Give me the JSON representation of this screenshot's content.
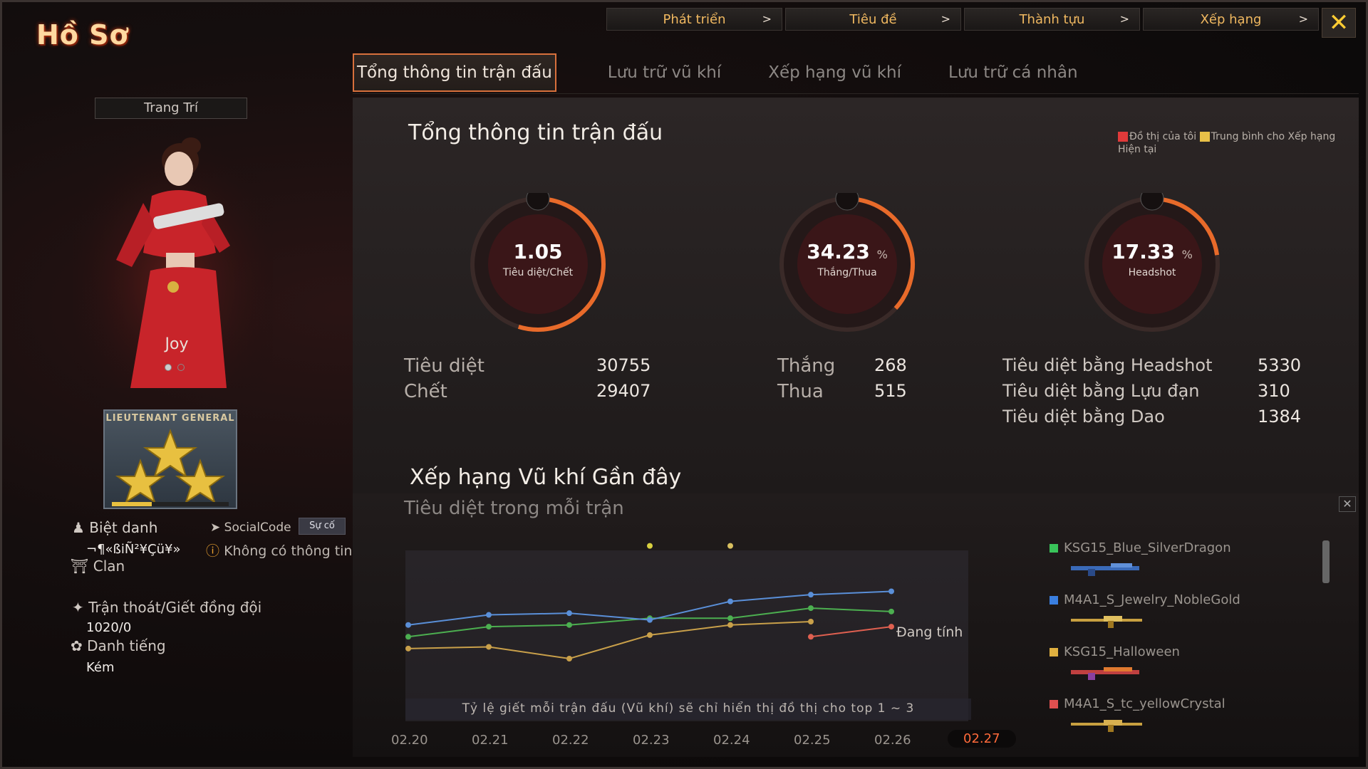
{
  "header": {
    "title": "Hồ Sơ"
  },
  "top_nav": [
    {
      "label": "Phát triển"
    },
    {
      "label": "Tiêu đề"
    },
    {
      "label": "Thành tựu"
    },
    {
      "label": "Xếp hạng"
    }
  ],
  "close_label": "✕",
  "tabs": [
    {
      "label": "Tổng thông tin trận đấu",
      "active": true
    },
    {
      "label": "Lưu trữ vũ khí"
    },
    {
      "label": "Xếp hạng vũ khí"
    },
    {
      "label": "Lưu trữ cá nhân"
    }
  ],
  "profile": {
    "decor_button": "Trang Trí",
    "character_name": "Joy",
    "rank_title": "LIEUTENANT GENERAL",
    "nickname_label": "Biệt danh",
    "nickname_value": "¬¶«ßiÑ²¥Çü¥»",
    "socialcode_label": "SocialCode",
    "socialcode_button": "Sự cố",
    "socialcode_value": "Không có thông tin",
    "clan_label": "Clan",
    "escape_label": "Trận thoát/Giết đồng đội",
    "escape_value": "1020/0",
    "reputation_label": "Danh tiếng",
    "reputation_value": "Kém"
  },
  "stats_panel": {
    "title": "Tổng thông tin trận đấu",
    "legend_mine": "Đồ thị của tôi",
    "legend_avg": "Trung bình cho Xếp hạng Hiện tại",
    "gauges": [
      {
        "value": "1.05",
        "unit": "",
        "label": "Tiêu diệt/Chết",
        "fill": 0.52
      },
      {
        "value": "34.23",
        "unit": "%",
        "label": "Thắng/Thua",
        "fill": 0.34
      },
      {
        "value": "17.33",
        "unit": "%",
        "label": "Headshot",
        "fill": 0.2
      }
    ],
    "kd": {
      "kills_label": "Tiêu diệt",
      "kills": "30755",
      "deaths_label": "Chết",
      "deaths": "29407"
    },
    "wl": {
      "wins_label": "Thắng",
      "wins": "268",
      "losses_label": "Thua",
      "losses": "515"
    },
    "special": [
      {
        "label": "Tiêu diệt bằng Headshot",
        "value": "5330"
      },
      {
        "label": "Tiêu diệt bằng Lựu đạn",
        "value": "310"
      },
      {
        "label": "Tiêu diệt bằng Dao",
        "value": "1384"
      }
    ]
  },
  "weapon_chart": {
    "title": "Xếp hạng Vũ khí Gần đây",
    "subtitle": "Tiêu diệt trong mỗi trận",
    "pending_label": "Đang tính",
    "note": "Tỷ lệ giết mỗi trận đấu (Vũ khí) sẽ chỉ hiển thị đồ thị cho top 1 ~ 3",
    "weapons": [
      {
        "name": "KSG15_Blue_SilverDragon",
        "color": "#39c45a"
      },
      {
        "name": "M4A1_S_Jewelry_NobleGold",
        "color": "#3a7fe0"
      },
      {
        "name": "KSG15_Halloween",
        "color": "#e0b040"
      },
      {
        "name": "M4A1_S_tc_yellowCrystal",
        "color": "#e05050"
      }
    ]
  },
  "chart_data": {
    "type": "line",
    "x": [
      "02.20",
      "02.21",
      "02.22",
      "02.23",
      "02.24",
      "02.25",
      "02.26",
      "02.27"
    ],
    "active_x": "02.27",
    "series": [
      {
        "name": "KSG15_Blue_SilverDragon",
        "color": "#4caf50",
        "values": [
          4.6,
          5.2,
          5.3,
          5.7,
          5.7,
          6.3,
          6.1,
          null
        ]
      },
      {
        "name": "M4A1_S_Jewelry_NobleGold",
        "color": "#5a8fd8",
        "values": [
          5.3,
          5.9,
          6.0,
          5.6,
          6.7,
          7.1,
          7.3,
          null
        ]
      },
      {
        "name": "KSG15_Halloween",
        "color": "#c9a04a",
        "values": [
          3.9,
          4.0,
          3.3,
          4.7,
          5.3,
          5.5,
          null,
          null
        ]
      },
      {
        "name": "M4A1_S_tc_yellowCrystal",
        "color": "#e06050",
        "values": [
          null,
          null,
          null,
          null,
          null,
          4.6,
          5.2,
          null
        ]
      }
    ],
    "outliers": [
      {
        "x": "02.23",
        "y": 10.0,
        "color": "#d8d040"
      },
      {
        "x": "02.24",
        "y": 10.0,
        "color": "#d8c060"
      }
    ],
    "ylim": [
      0,
      11
    ]
  }
}
